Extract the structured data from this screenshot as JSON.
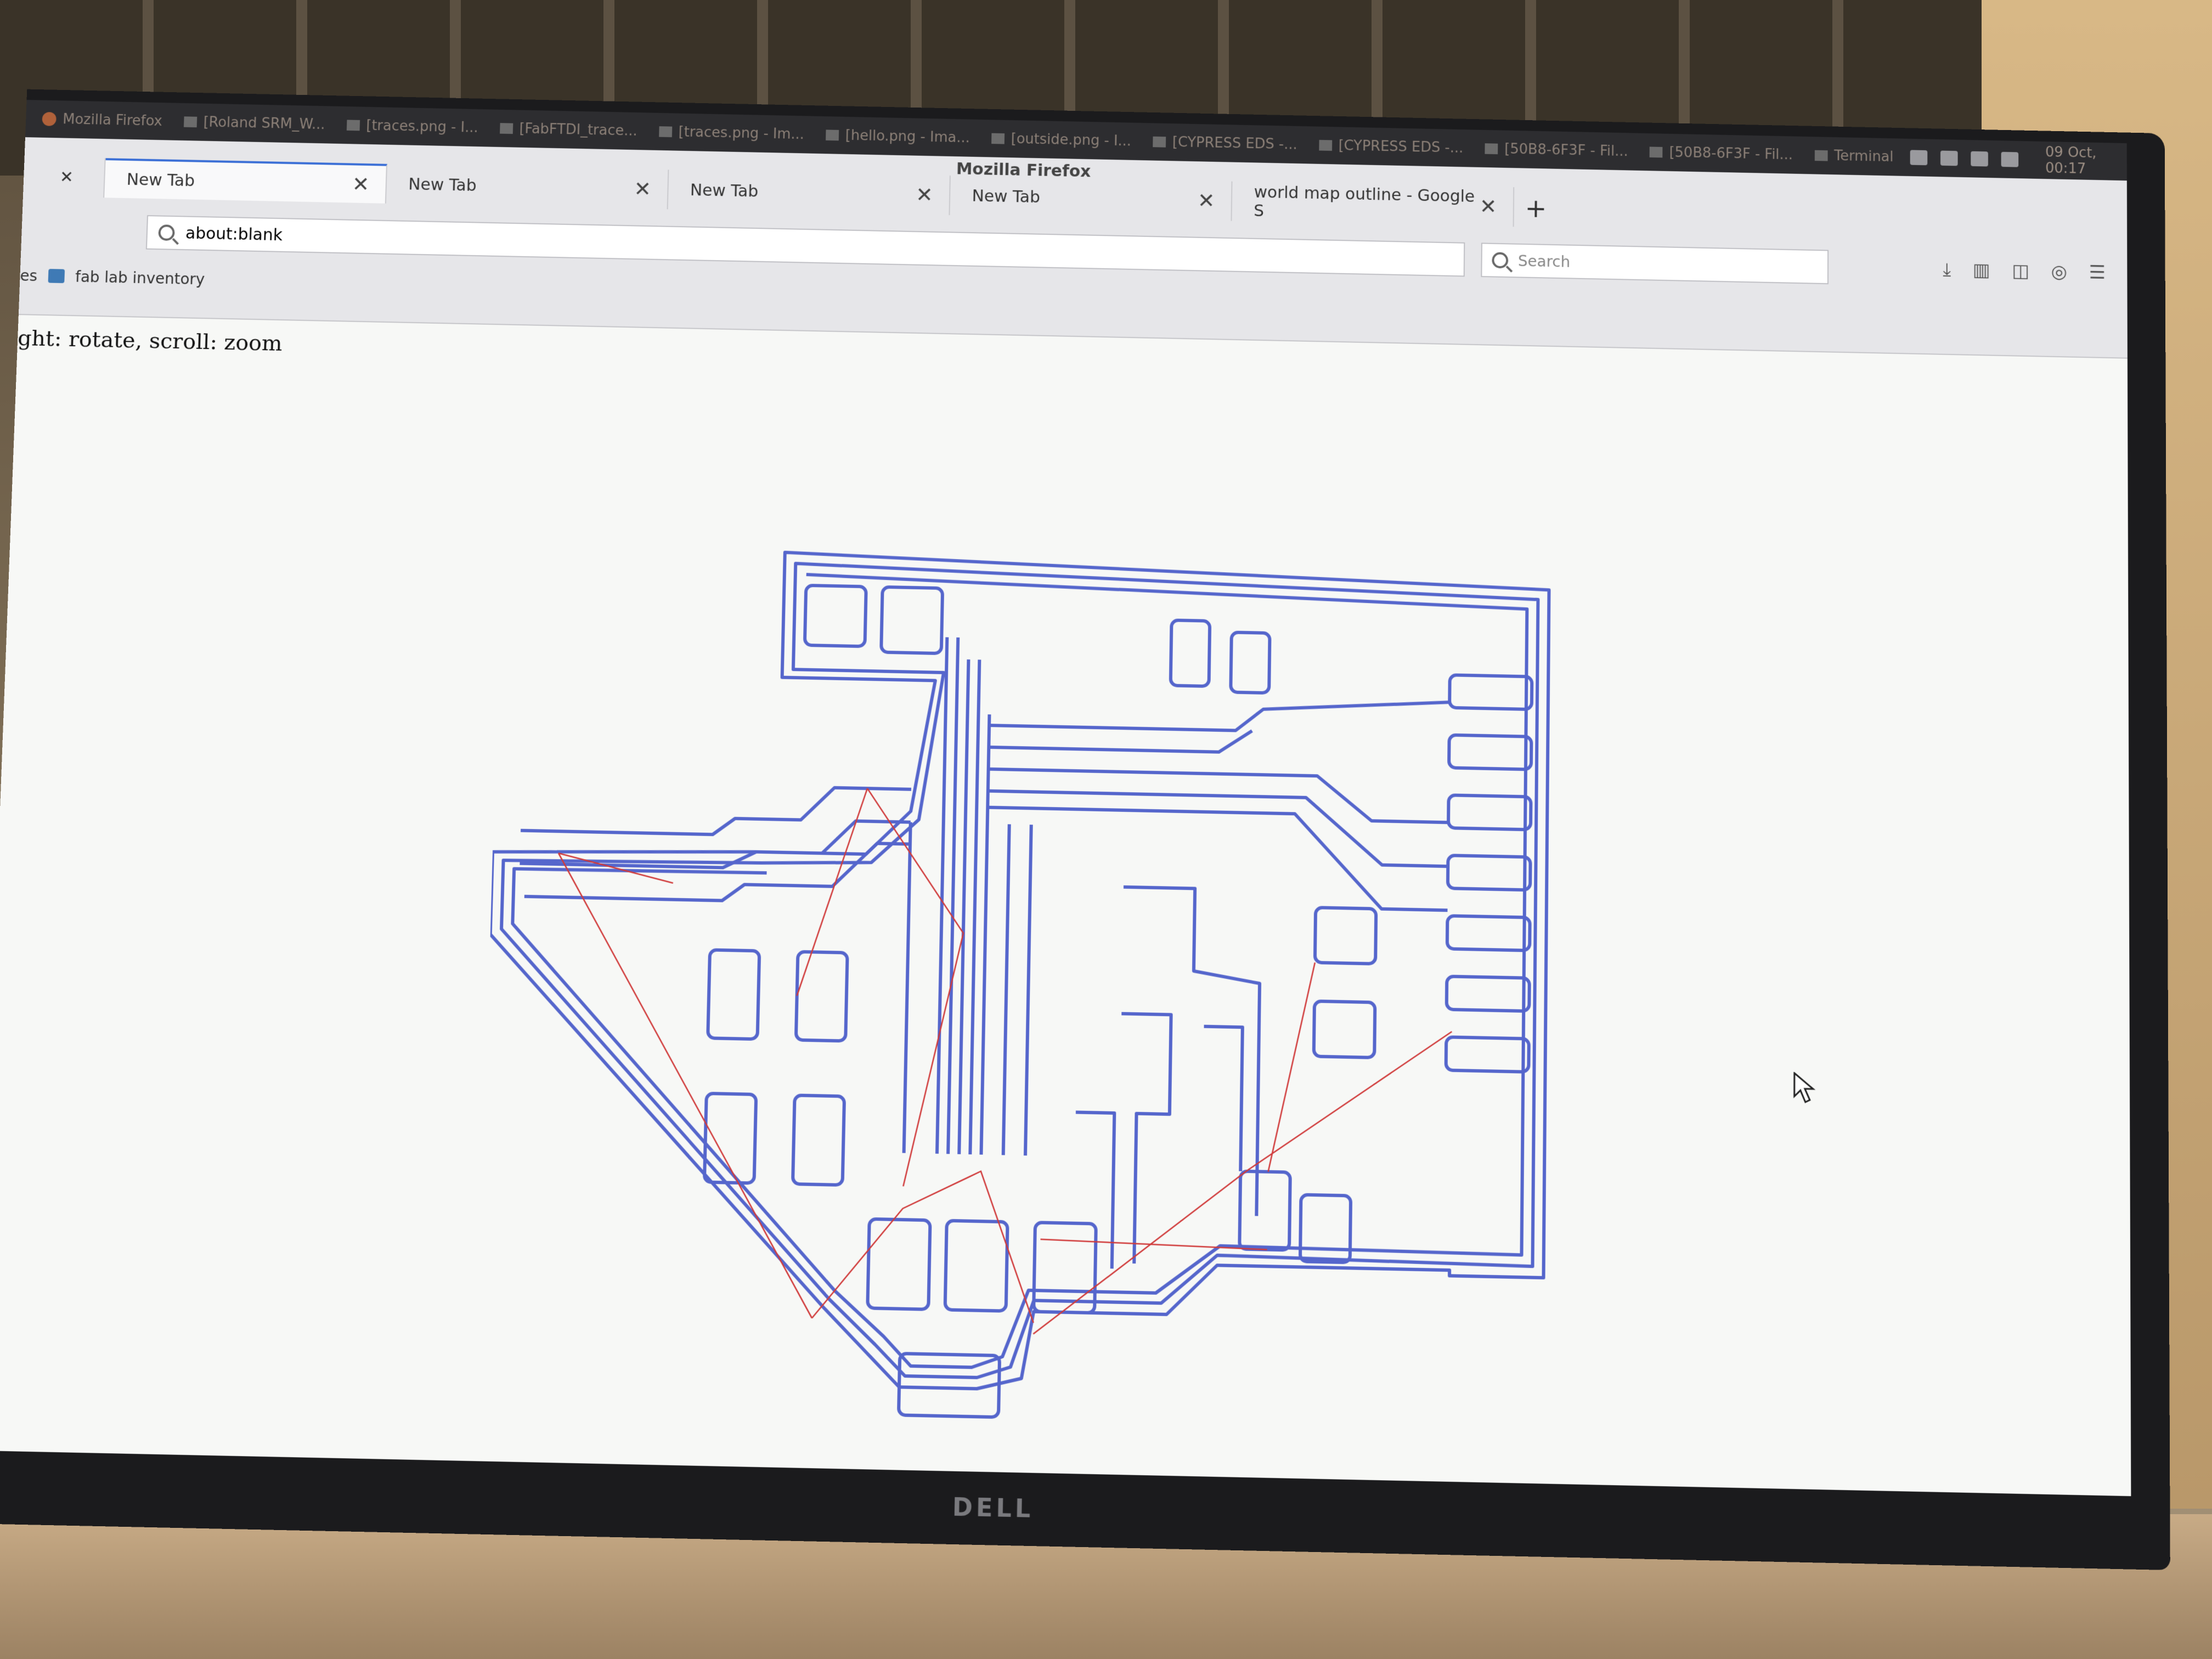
{
  "system_bar": {
    "tasks": [
      {
        "label": "Mozilla Firefox",
        "icon": "firefox-icon"
      },
      {
        "label": "[Roland SRM_W...",
        "icon": "window-icon"
      },
      {
        "label": "[traces.png - I...",
        "icon": "window-icon"
      },
      {
        "label": "[FabFTDI_trace...",
        "icon": "window-icon"
      },
      {
        "label": "[traces.png - Im...",
        "icon": "window-icon"
      },
      {
        "label": "[hello.png - Ima...",
        "icon": "window-icon"
      },
      {
        "label": "[outside.png - I...",
        "icon": "window-icon"
      },
      {
        "label": "[CYPRESS EDS -...",
        "icon": "folder-icon"
      },
      {
        "label": "[CYPRESS EDS -...",
        "icon": "folder-icon"
      },
      {
        "label": "[50B8-6F3F - Fil...",
        "icon": "folder-icon"
      },
      {
        "label": "[50B8-6F3F - Fil...",
        "icon": "folder-icon"
      },
      {
        "label": "Terminal",
        "icon": "terminal-icon"
      }
    ],
    "clock": "09 Oct, 00:17"
  },
  "browser": {
    "window_title": "Mozilla Firefox",
    "tabs": [
      {
        "label": "New Tab",
        "active": true
      },
      {
        "label": "New Tab",
        "active": false
      },
      {
        "label": "New Tab",
        "active": false
      },
      {
        "label": "New Tab",
        "active": false
      },
      {
        "label": "world map outline - Google S",
        "active": false
      }
    ],
    "close_glyph": "✕",
    "new_tab_glyph": "+",
    "url": "about:blank",
    "search_placeholder": "Search",
    "bookmarks": [
      {
        "label": "es"
      },
      {
        "label": "fab lab inventory"
      }
    ]
  },
  "page": {
    "hint_text": "ght: rotate, scroll: zoom"
  },
  "monitor": {
    "brand": "DELL"
  },
  "colors": {
    "trace": "#5566cc",
    "rapid_move": "#d03a3a",
    "axis_x": "#d03a3a",
    "axis_y": "#3aa03a",
    "accent": "#3b6fd6"
  }
}
